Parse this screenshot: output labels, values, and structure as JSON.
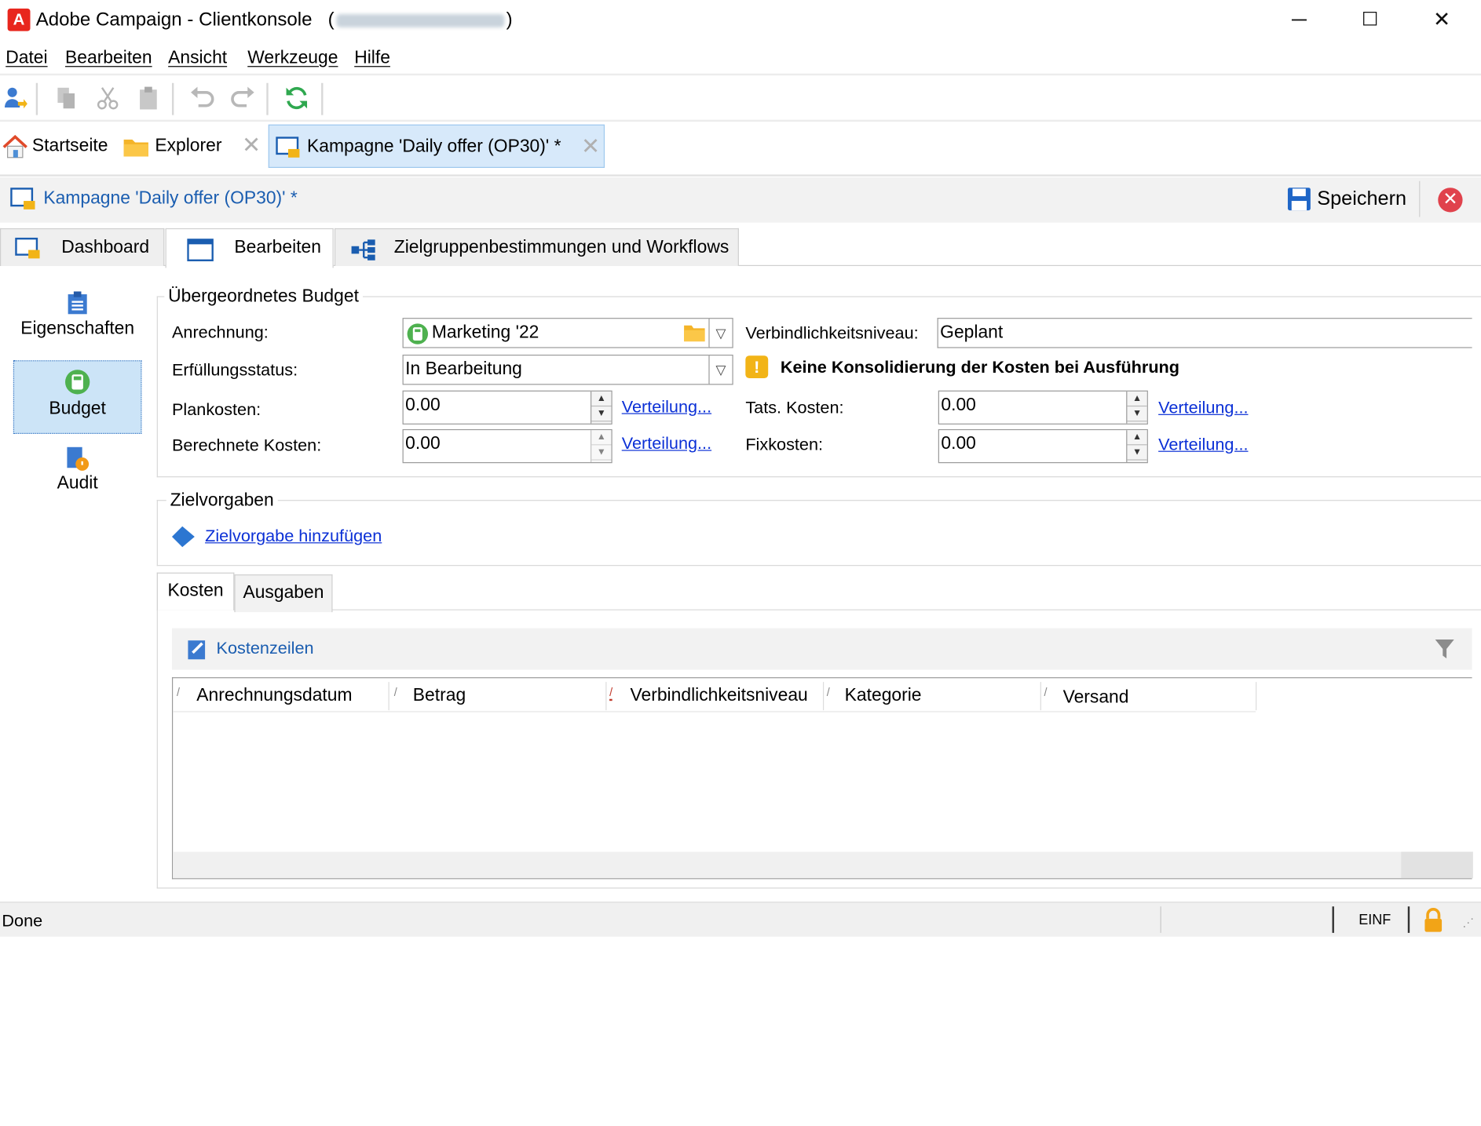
{
  "window": {
    "app_logo": "A",
    "title_app": "Adobe Campaign - ",
    "title_console": "Clientkonsole",
    "title_paren_open": "(",
    "title_paren_close": ")",
    "minimize": "─",
    "maximize": "☐",
    "close": "✕"
  },
  "menu": [
    "Datei",
    "Bearbeiten",
    "Ansicht",
    "Werkzeuge",
    "Hilfe"
  ],
  "top_tabs": {
    "home": "Startseite",
    "explorer": "Explorer",
    "campaign": "Kampagne 'Daily offer  (OP30)' *"
  },
  "header": {
    "breadcrumb": "Kampagne 'Daily offer  (OP30)' *",
    "save": "Speichern"
  },
  "sub_tabs": {
    "dashboard": "Dashboard",
    "edit": "Bearbeiten",
    "targeting": "Zielgruppenbestimmungen und Workflows"
  },
  "sidebar": {
    "properties": "Eigenschaften",
    "budget": "Budget",
    "audit": "Audit"
  },
  "budget_section": {
    "legend": "Übergeordnetes Budget",
    "allocation_label": "Anrechnung:",
    "allocation_value": "Marketing '22",
    "commitment_label": "Verbindlichkeitsniveau:",
    "commitment_value": "Geplant",
    "status_label": "Erfüllungsstatus:",
    "status_value": "In Bearbeitung",
    "warning": "Keine Konsolidierung der Kosten bei Ausführung",
    "planned_label": "Plankosten:",
    "planned_value": "0.00",
    "actual_label": "Tats. Kosten:",
    "actual_value": "0.00",
    "calculated_label": "Berechnete Kosten:",
    "calculated_value": "0.00",
    "fixed_label": "Fixkosten:",
    "fixed_value": "0.00",
    "distribution_link": "Verteilung..."
  },
  "targets_section": {
    "legend": "Zielvorgaben",
    "add_link": "Zielvorgabe hinzufügen"
  },
  "bottom_tabs": {
    "costs": "Kosten",
    "expenses": "Ausgaben"
  },
  "cost_lines": {
    "title": "Kostenzeilen",
    "columns": [
      "Anrechnungsdatum",
      "Betrag",
      "Verbindlichkeitsniveau",
      "Kategorie",
      "Versand"
    ]
  },
  "status": {
    "text": "Done",
    "mode": "EINF"
  }
}
